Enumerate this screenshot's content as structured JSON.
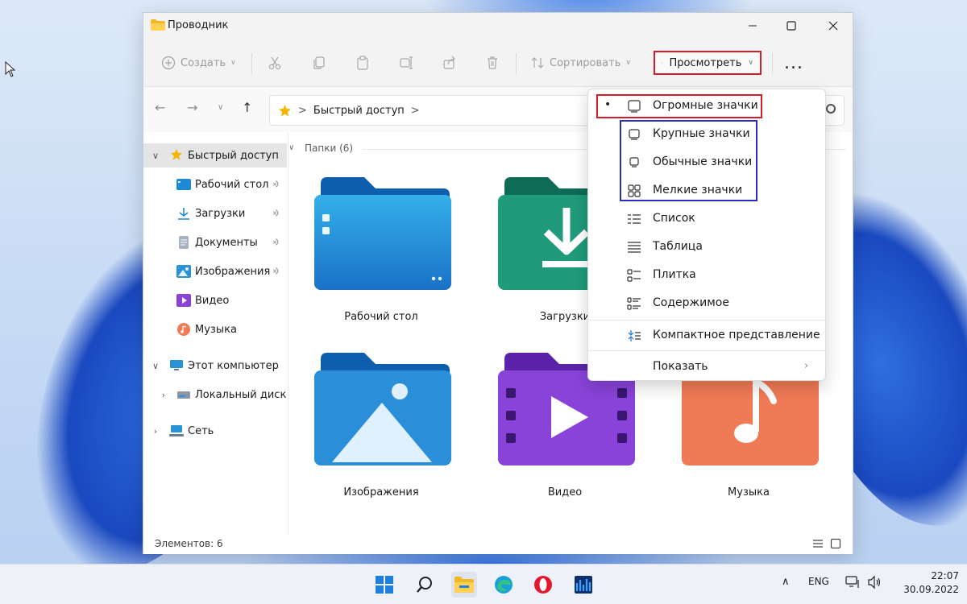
{
  "window": {
    "title": "Проводник"
  },
  "toolbar": {
    "create_label": "Создать",
    "sort_label": "Сортировать",
    "view_label": "Просмотреть",
    "more_label": "..."
  },
  "address": {
    "root_label": "Быстрый доступ",
    "separator": ">"
  },
  "sidebar": {
    "items": [
      {
        "label": "Быстрый доступ",
        "icon": "star-icon",
        "selected": true,
        "expanded": true
      },
      {
        "label": "Рабочий стол",
        "icon": "desktop-folder-icon",
        "pinned": true
      },
      {
        "label": "Загрузки",
        "icon": "download-icon",
        "pinned": true
      },
      {
        "label": "Документы",
        "icon": "documents-icon",
        "pinned": true
      },
      {
        "label": "Изображения",
        "icon": "pictures-icon",
        "pinned": true
      },
      {
        "label": "Видео",
        "icon": "video-icon"
      },
      {
        "label": "Музыка",
        "icon": "music-icon"
      },
      {
        "label": "Этот компьютер",
        "icon": "computer-icon",
        "expanded": true
      },
      {
        "label": "Локальный диск (С",
        "icon": "drive-icon"
      },
      {
        "label": "Сеть",
        "icon": "network-icon"
      }
    ]
  },
  "content": {
    "group_header": "Папки (6)",
    "folders": [
      {
        "label": "Рабочий стол",
        "icon": "desktop-folder-icon"
      },
      {
        "label": "Загрузки",
        "icon": "downloads-folder-icon"
      },
      {
        "label": "Изображения",
        "icon": "pictures-folder-icon"
      },
      {
        "label": "Видео",
        "icon": "video-folder-icon"
      },
      {
        "label": "Музыка",
        "icon": "music-folder-icon"
      }
    ]
  },
  "status": {
    "count_text": "Элементов: 6"
  },
  "view_menu": {
    "items": [
      {
        "label": "Огромные значки",
        "icon": "extra-large-icons-icon",
        "selected": true
      },
      {
        "label": "Крупные значки",
        "icon": "large-icons-icon"
      },
      {
        "label": "Обычные значки",
        "icon": "medium-icons-icon"
      },
      {
        "label": "Мелкие значки",
        "icon": "small-icons-icon"
      },
      {
        "label": "Список",
        "icon": "list-icon"
      },
      {
        "label": "Таблица",
        "icon": "details-icon"
      },
      {
        "label": "Плитка",
        "icon": "tiles-icon"
      },
      {
        "label": "Содержимое",
        "icon": "content-icon"
      },
      {
        "label": "Компактное представление",
        "icon": "compact-view-icon"
      },
      {
        "label": "Показать",
        "icon": "submenu-arrow-icon",
        "has_submenu": true
      }
    ]
  },
  "taskbar": {
    "language": "ENG",
    "time": "22:07",
    "date": "30.09.2022"
  },
  "colors": {
    "highlight_red": "#d51b2c",
    "highlight_blue": "#2b2bbf",
    "folder_blue": "#1e8fd6",
    "folder_green": "#1f9a7a",
    "folder_purple": "#8a43d9",
    "folder_orange": "#f07a55"
  }
}
